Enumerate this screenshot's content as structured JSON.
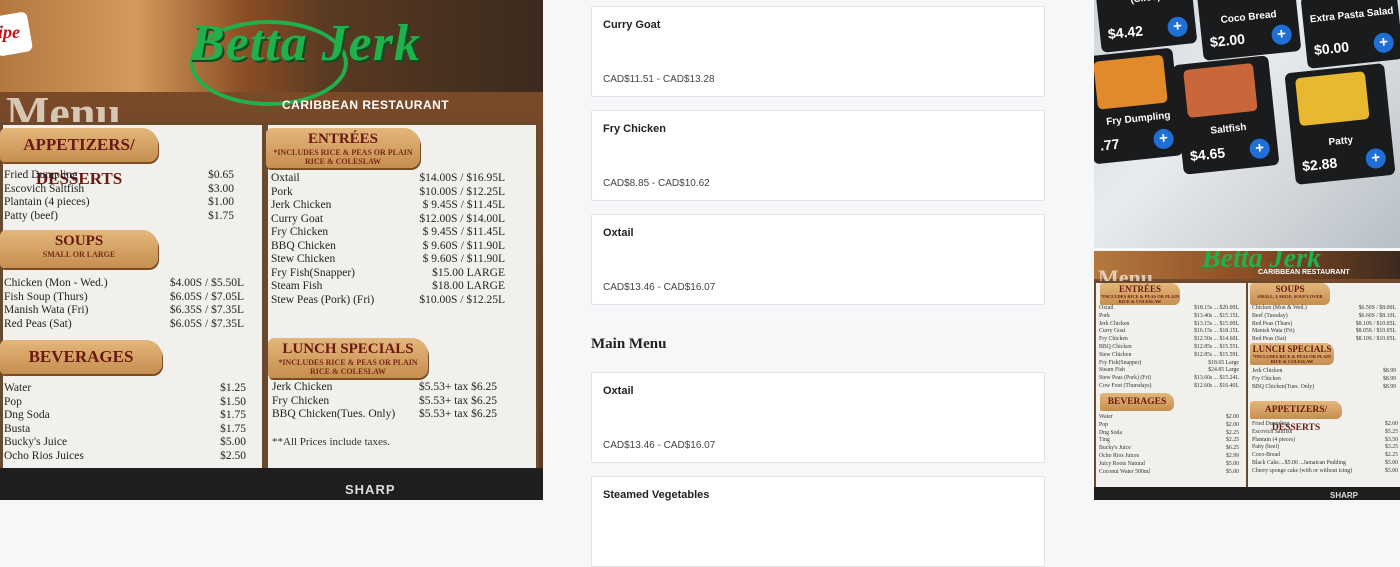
{
  "left_photo": {
    "chip_text": "ipe",
    "logo": "Betta Jerk",
    "restaurant": "CARIBBEAN RESTAURANT",
    "menu_word": "Menu",
    "appetizers": {
      "title": "APPETIZERS/ DESSERTS",
      "items": [
        {
          "name": "Fried Dumpling",
          "price": "$0.65"
        },
        {
          "name": "Escovich Saltfish",
          "price": "$3.00"
        },
        {
          "name": "Plantain (4 pieces)",
          "price": "$1.00"
        },
        {
          "name": "Patty (beef)",
          "price": "$1.75"
        }
      ]
    },
    "soups": {
      "title": "SOUPS",
      "subtitle": "SMALL OR LARGE",
      "items": [
        {
          "name": "Chicken (Mon - Wed.)",
          "price": "$4.00S / $5.50L"
        },
        {
          "name": "Fish Soup (Thurs)",
          "price": "$6.05S / $7.05L"
        },
        {
          "name": "Manish Wata (Fri)",
          "price": "$6.35S / $7.35L"
        },
        {
          "name": "Red Peas (Sat)",
          "price": "$6.05S / $7.35L"
        }
      ]
    },
    "beverages": {
      "title": "BEVERAGES",
      "items": [
        {
          "name": "Water",
          "price": "$1.25"
        },
        {
          "name": "Pop",
          "price": "$1.50"
        },
        {
          "name": "Dng Soda",
          "price": "$1.75"
        },
        {
          "name": "Busta",
          "price": "$1.75"
        },
        {
          "name": "Bucky's Juice",
          "price": "$5.00"
        },
        {
          "name": "Ocho Rios Juices",
          "price": "$2.50"
        }
      ]
    },
    "entrees": {
      "title": "ENTRÉES",
      "subtitle": "*INCLUDES RICE & PEAS OR PLAIN RICE & COLESLAW",
      "items": [
        {
          "name": "Oxtail",
          "price": "$14.00S / $16.95L"
        },
        {
          "name": "Pork",
          "price": "$10.00S / $12.25L"
        },
        {
          "name": "Jerk Chicken",
          "price": "$ 9.45S / $11.45L"
        },
        {
          "name": "Curry Goat",
          "price": "$12.00S / $14.00L"
        },
        {
          "name": "Fry Chicken",
          "price": "$ 9.45S / $11.45L"
        },
        {
          "name": "BBQ Chicken",
          "price": "$ 9.60S / $11.90L"
        },
        {
          "name": "Stew Chicken",
          "price": "$ 9.60S / $11.90L"
        },
        {
          "name": "Fry Fish(Snapper)",
          "price": "$15.00 LARGE"
        },
        {
          "name": "Steam Fish",
          "price": "$18.00 LARGE"
        },
        {
          "name": "Stew Peas (Pork) (Fri)",
          "price": "$10.00S / $12.25L"
        }
      ]
    },
    "lunch": {
      "title": "LUNCH SPECIALS",
      "subtitle": "*INCLUDES RICE & PEAS OR PLAIN RICE & COLESLAW",
      "items": [
        {
          "name": "Jerk Chicken",
          "price": "$5.53+ tax $6.25"
        },
        {
          "name": "Fry Chicken",
          "price": "$5.53+ tax $6.25"
        },
        {
          "name": "BBQ Chicken(Tues. Only)",
          "price": "$5.53+ tax $6.25"
        }
      ],
      "note": "**All Prices include taxes."
    },
    "tv_brand": "SHARP"
  },
  "center": {
    "cards_top": [
      {
        "name": "Curry Goat",
        "price": "CAD$11.51 - CAD$13.28"
      },
      {
        "name": "Fry Chicken",
        "price": "CAD$8.85 - CAD$10.62"
      },
      {
        "name": "Oxtail",
        "price": "CAD$13.46 - CAD$16.07"
      }
    ],
    "section_title": "Main Menu",
    "cards_main": [
      {
        "name": "Oxtail",
        "price": "CAD$13.46 - CAD$16.07"
      },
      {
        "name": "Steamed Vegetables",
        "price": ""
      }
    ]
  },
  "right_top": {
    "tiles": [
      {
        "name": "Banana Bread (Slice)",
        "price": "$4.42",
        "img_color": "#c8a36a"
      },
      {
        "name": "Coco Bread",
        "price": "$2.00",
        "img_color": "#d7b880"
      },
      {
        "name": "Extra Pasta Salad",
        "price": "$0.00",
        "img_color": "#e0c890"
      },
      {
        "name": "Fry Dumpling",
        "price": ".77",
        "img_color": "#e08a2c"
      },
      {
        "name": "Saltfish",
        "price": "$4.65",
        "img_color": "#c9673a"
      },
      {
        "name": "Patty",
        "price": "$2.88",
        "img_color": "#e8b830"
      }
    ],
    "plus": "+"
  },
  "right_bottom": {
    "logo": "Betta Jerk",
    "restaurant": "CARIBBEAN RESTAURANT",
    "menu_word": "Menu",
    "entrees_title": "ENTRÉES",
    "entrees_sub": "*INCLUDES RICE & PEAS OR PLAIN RICE & COLESLAW",
    "entrees": [
      {
        "name": "Oxtail",
        "price": "$18.15s ... $20.00L"
      },
      {
        "name": "Pork",
        "price": "$13.40s ... $15.15L"
      },
      {
        "name": "Jerk Chicken",
        "price": "$13.15s ... $15.00L"
      },
      {
        "name": "Curry Goat",
        "price": "$16.15s ... $18.15L"
      },
      {
        "name": "Fry Chicken",
        "price": "$12.50s ... $14.60L"
      },
      {
        "name": "BBQ Chicken",
        "price": "$12.85s ... $15.55L"
      },
      {
        "name": "Stew Chicken",
        "price": "$12.85s ... $15.59L"
      },
      {
        "name": "Fry Fish(Snapper)",
        "price": "$18.65 Large"
      },
      {
        "name": "Steam Fish",
        "price": "$24.85 Large"
      },
      {
        "name": "Stew Peas (Pork) (Fri)",
        "price": "$13.60s ... $15.24L"
      },
      {
        "name": "Cow Foot (Thursdays)",
        "price": "$12.60s ... $16.40L"
      }
    ],
    "beverages_title": "BEVERAGES",
    "beverages": [
      {
        "name": "Water",
        "price": "$2.00"
      },
      {
        "name": "Pop",
        "price": "$2.00"
      },
      {
        "name": "Dng Soda",
        "price": "$2.25"
      },
      {
        "name": "Ting",
        "price": "$2.25"
      },
      {
        "name": "Bucky's Juice",
        "price": "$6.25"
      },
      {
        "name": "Ocho Rios Juices",
        "price": "$2.99"
      },
      {
        "name": "Juicy Roots Natural",
        "price": "$5.00"
      },
      {
        "name": "Coconut Water 500ml",
        "price": "$5.00"
      }
    ],
    "soups_title": "SOUPS",
    "soups_sub": "SMALL, LARGE, SOUP LOVER",
    "soups": [
      {
        "name": "Chicken (Mon & Wed.)",
        "price": "$6.50S / $8.00L"
      },
      {
        "name": "Beef (Tuesday)",
        "price": "$6.60S / $8.10L"
      },
      {
        "name": "Red Peas (Thurs)",
        "price": "$8.10S / $10.05L"
      },
      {
        "name": "Manish Wata (Fri)",
        "price": "$8.05S / $10.05L"
      },
      {
        "name": "Red Peas (Sat)",
        "price": "$8.10S / $10.05L"
      }
    ],
    "lunch_title": "LUNCH SPECIALS",
    "lunch_sub": "*INCLUDES RICE & PEAS OR PLAIN RICE & COLESLAW",
    "lunch": [
      {
        "name": "Jerk Chicken",
        "price": "$8.99"
      },
      {
        "name": "Fry Chicken",
        "price": "$8.99"
      },
      {
        "name": "BBQ Chicken(Tues. Only)",
        "price": "$8.99"
      }
    ],
    "apps_title": "APPETIZERS/ DESSERTS",
    "apps": [
      {
        "name": "Fried Dumpling",
        "price": "$2.00"
      },
      {
        "name": "Escovich Saltfish",
        "price": "$5.25"
      },
      {
        "name": "Plantain (4 pieces)",
        "price": "$3.50"
      },
      {
        "name": "Patty (beef)",
        "price": "$3.25"
      },
      {
        "name": "Coco-Bread",
        "price": "$2.25"
      },
      {
        "name": "Black Cake....$5.00 ...Jamaican Pudding",
        "price": "$5.00"
      },
      {
        "name": "Cherry sponge cake (with or without icing)",
        "price": "$5.00"
      }
    ],
    "tv_brand": "SHARP"
  }
}
